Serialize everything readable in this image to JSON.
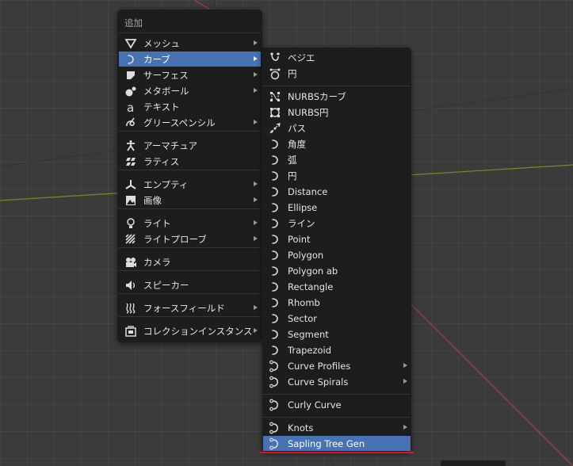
{
  "add_menu": {
    "title": "追加",
    "items": [
      {
        "label": "メッシュ",
        "icon": "mesh-icon",
        "submenu": true
      },
      {
        "label": "カーブ",
        "icon": "curve-icon",
        "submenu": true,
        "active": true
      },
      {
        "label": "サーフェス",
        "icon": "surface-icon",
        "submenu": true
      },
      {
        "label": "メタボール",
        "icon": "metaball-icon",
        "submenu": true
      },
      {
        "label": "テキスト",
        "icon": "text-icon",
        "submenu": false
      },
      {
        "label": "グリースペンシル",
        "icon": "grease-pencil-icon",
        "submenu": true
      },
      {
        "label": "アーマチュア",
        "icon": "armature-icon",
        "submenu": false
      },
      {
        "label": "ラティス",
        "icon": "lattice-icon",
        "submenu": false
      },
      {
        "label": "エンプティ",
        "icon": "empty-icon",
        "submenu": true
      },
      {
        "label": "画像",
        "icon": "image-icon",
        "submenu": true
      },
      {
        "label": "ライト",
        "icon": "light-icon",
        "submenu": true
      },
      {
        "label": "ライトプローブ",
        "icon": "light-probe-icon",
        "submenu": true
      },
      {
        "label": "カメラ",
        "icon": "camera-icon",
        "submenu": false
      },
      {
        "label": "スピーカー",
        "icon": "speaker-icon",
        "submenu": false
      },
      {
        "label": "フォースフィールド",
        "icon": "force-field-icon",
        "submenu": true
      },
      {
        "label": "コレクションインスタンス",
        "icon": "collection-instance-icon",
        "submenu": true
      }
    ]
  },
  "curve_menu": {
    "items": [
      {
        "label": "ベジエ",
        "icon": "bezier-icon",
        "submenu": false
      },
      {
        "label": "円",
        "icon": "bezier-circle-icon",
        "submenu": false
      },
      {
        "label": "NURBSカーブ",
        "icon": "nurbs-curve-icon",
        "submenu": false
      },
      {
        "label": "NURBS円",
        "icon": "nurbs-circle-icon",
        "submenu": false
      },
      {
        "label": "パス",
        "icon": "path-icon",
        "submenu": false
      },
      {
        "label": "角度",
        "icon": "curve-icon",
        "submenu": false
      },
      {
        "label": "弧",
        "icon": "curve-icon",
        "submenu": false
      },
      {
        "label": "円",
        "icon": "curve-icon",
        "submenu": false
      },
      {
        "label": "Distance",
        "icon": "curve-icon",
        "submenu": false
      },
      {
        "label": "Ellipse",
        "icon": "curve-icon",
        "submenu": false
      },
      {
        "label": "ライン",
        "icon": "curve-icon",
        "submenu": false
      },
      {
        "label": "Point",
        "icon": "curve-icon",
        "submenu": false
      },
      {
        "label": "Polygon",
        "icon": "curve-icon",
        "submenu": false
      },
      {
        "label": "Polygon ab",
        "icon": "curve-icon",
        "submenu": false
      },
      {
        "label": "Rectangle",
        "icon": "curve-icon",
        "submenu": false
      },
      {
        "label": "Rhomb",
        "icon": "curve-icon",
        "submenu": false
      },
      {
        "label": "Sector",
        "icon": "curve-icon",
        "submenu": false
      },
      {
        "label": "Segment",
        "icon": "curve-icon",
        "submenu": false
      },
      {
        "label": "Trapezoid",
        "icon": "curve-icon",
        "submenu": false
      },
      {
        "label": "Curve Profiles",
        "icon": "curve-data-icon",
        "submenu": true
      },
      {
        "label": "Curve Spirals",
        "icon": "curve-data-icon",
        "submenu": true
      },
      {
        "label": "Curly Curve",
        "icon": "curve-data-icon",
        "submenu": false
      },
      {
        "label": "Knots",
        "icon": "curve-data-icon",
        "submenu": true
      },
      {
        "label": "Sapling Tree Gen",
        "icon": "curve-data-icon",
        "submenu": false,
        "active": true
      }
    ]
  },
  "colors": {
    "menu_bg": "#1d1d1d",
    "highlight": "#4772b3",
    "viewport_bg": "#3b3b3b",
    "x_axis": "#b13b45",
    "y_axis": "#6a8f2a",
    "annotation_underline": "#e0141a"
  }
}
